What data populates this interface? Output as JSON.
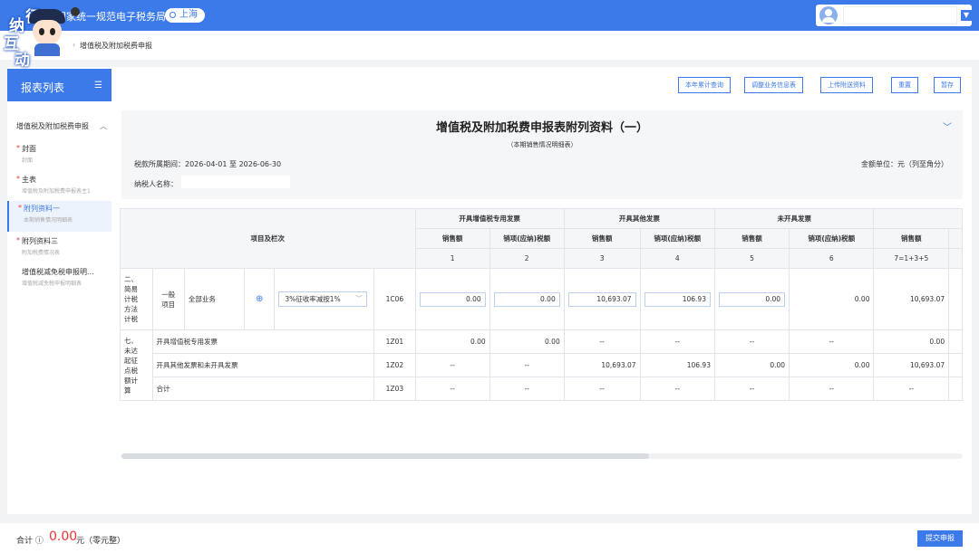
{
  "header": {
    "title": "国家统一规范电子税务局",
    "region": "上海",
    "mascot_chars": [
      "征",
      "纳",
      "互",
      "动"
    ]
  },
  "breadcrumb": {
    "current": "增值税及附加税费申报"
  },
  "sidebar": {
    "title": "报表列表",
    "group": "增值税及附加税费申报",
    "items": [
      {
        "label": "封面",
        "sub": "封面",
        "required": true
      },
      {
        "label": "主表",
        "sub": "增值税及附加税费申报表主1",
        "required": true
      },
      {
        "label": "附列资料一",
        "sub": "本期销售情况明细表",
        "required": true,
        "active": true
      },
      {
        "label": "附列资料三",
        "sub": "附加税费情况表",
        "required": true
      },
      {
        "label": "增值税减免税申报明...",
        "sub": "增值税减免税申报明细表",
        "required": false
      }
    ]
  },
  "toolbar": {
    "buttons": [
      "本年累计查询",
      "调整业务信息表",
      "上传附送资料",
      "重置",
      "暂存"
    ]
  },
  "form": {
    "title": "增值税及附加税费申报表附列资料（一）",
    "subtitle": "（本期销售情况明细表）",
    "period": "税款所属期间：2026-04-01 至 2026-06-30",
    "unit": "金额单位：元（列至角分）",
    "payer_label": "纳税人名称："
  },
  "table": {
    "item_header": "项目及栏次",
    "groups": [
      "开具增值税专用发票",
      "开具其他发票",
      "未开具发票"
    ],
    "sub_headers": [
      "销售额",
      "销项(应纳)税额",
      "销售额",
      "销项(应纳)税额",
      "销售额",
      "销项(应纳)税额",
      "销售额"
    ],
    "col_nums": [
      "1",
      "2",
      "3",
      "4",
      "5",
      "6",
      "7=1+3+5"
    ],
    "section2": {
      "label": [
        "二、",
        "简易",
        "计税",
        "方法",
        "计税"
      ],
      "sub": [
        "一般",
        "项目"
      ],
      "business": "全部业务",
      "rate_select": "3%征收率减按1%",
      "code": "1C06",
      "values": [
        "0.00",
        "0.00",
        "10,693.07",
        "106.93",
        "0.00",
        "0.00",
        "10,693.07"
      ]
    },
    "section7": {
      "label": [
        "七、",
        "未达",
        "起征",
        "点税",
        "额计",
        "算"
      ],
      "rows": [
        {
          "name": "开具增值税专用发票",
          "code": "1Z01",
          "values": [
            "0.00",
            "0.00",
            "--",
            "--",
            "--",
            "--",
            "0.00"
          ]
        },
        {
          "name": "开具其他发票和未开具发票",
          "code": "1Z02",
          "values": [
            "--",
            "--",
            "10,693.07",
            "106.93",
            "0.00",
            "0.00",
            "10,693.07"
          ]
        },
        {
          "name": "合计",
          "code": "1Z03",
          "values": [
            "--",
            "--",
            "--",
            "--",
            "--",
            "--",
            "--"
          ]
        }
      ]
    }
  },
  "footer": {
    "total_label": "合计 ⓘ",
    "total_value": "0.00",
    "total_unit": "元（零元整）",
    "submit": "提交申报"
  }
}
